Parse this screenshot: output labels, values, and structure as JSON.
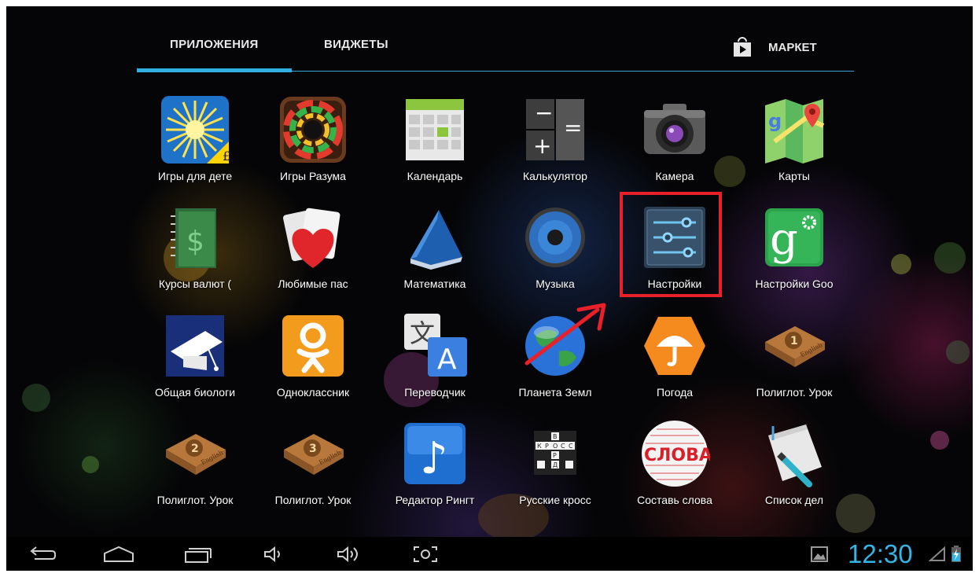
{
  "tabs": {
    "apps": "ПРИЛОЖЕНИЯ",
    "widgets": "ВИДЖЕТЫ",
    "market": "МАРКЕТ"
  },
  "apps": [
    {
      "label": "Игры для дете",
      "icon": "sun-icon"
    },
    {
      "label": "Игры Разума",
      "icon": "colorful-ring-icon"
    },
    {
      "label": "Календарь",
      "icon": "calendar-icon"
    },
    {
      "label": "Калькулятор",
      "icon": "calculator-icon"
    },
    {
      "label": "Камера",
      "icon": "camera-icon"
    },
    {
      "label": "Карты",
      "icon": "maps-icon"
    },
    {
      "label": "Курсы валют (",
      "icon": "notepad-dollar-icon"
    },
    {
      "label": "Любимые пас",
      "icon": "playing-cards-heart-icon"
    },
    {
      "label": "Математика",
      "icon": "blue-book-icon"
    },
    {
      "label": "Музыка",
      "icon": "speaker-icon"
    },
    {
      "label": "Настройки",
      "icon": "settings-sliders-icon"
    },
    {
      "label": "Настройки Goo",
      "icon": "google-settings-icon"
    },
    {
      "label": "Общая биологи",
      "icon": "graduation-cap-icon"
    },
    {
      "label": "Одноклассник",
      "icon": "odnoklassniki-icon"
    },
    {
      "label": "Переводчик",
      "icon": "translate-icon"
    },
    {
      "label": "Планета Земл",
      "icon": "earth-globe-icon"
    },
    {
      "label": "Погода",
      "icon": "umbrella-icon"
    },
    {
      "label": "Полиглот. Урок",
      "icon": "english-book-1-icon"
    },
    {
      "label": "Полиглот. Урок",
      "icon": "english-book-2-icon"
    },
    {
      "label": "Полиглот. Урок",
      "icon": "english-book-3-icon"
    },
    {
      "label": "Редактор Рингт",
      "icon": "music-note-icon"
    },
    {
      "label": "Русские кросс",
      "icon": "crossword-icon"
    },
    {
      "label": "Составь слова",
      "icon": "slova-words-icon"
    },
    {
      "label": "Список дел",
      "icon": "paper-pen-icon"
    }
  ],
  "icon_text": {
    "calc_minus": "−",
    "calc_equals": "=",
    "calc_plus": "+",
    "sun_badge": "£",
    "dollar": "$",
    "google_g": "g",
    "ok_glyph": "8",
    "translate_cn": "文",
    "translate_a": "A",
    "weather_j": "J",
    "book1_num": "1",
    "book2_num": "2",
    "book3_num": "3",
    "book_word": "English",
    "note_glyph": "♪",
    "slova_word": "СЛОВА",
    "cross_letters": [
      "В",
      "К",
      "Р",
      "О",
      "С",
      "С",
      "Р",
      "Д"
    ]
  },
  "status": {
    "time": "12:30"
  },
  "colors": {
    "accent": "#33b5e5",
    "highlight": "#e8202a"
  }
}
